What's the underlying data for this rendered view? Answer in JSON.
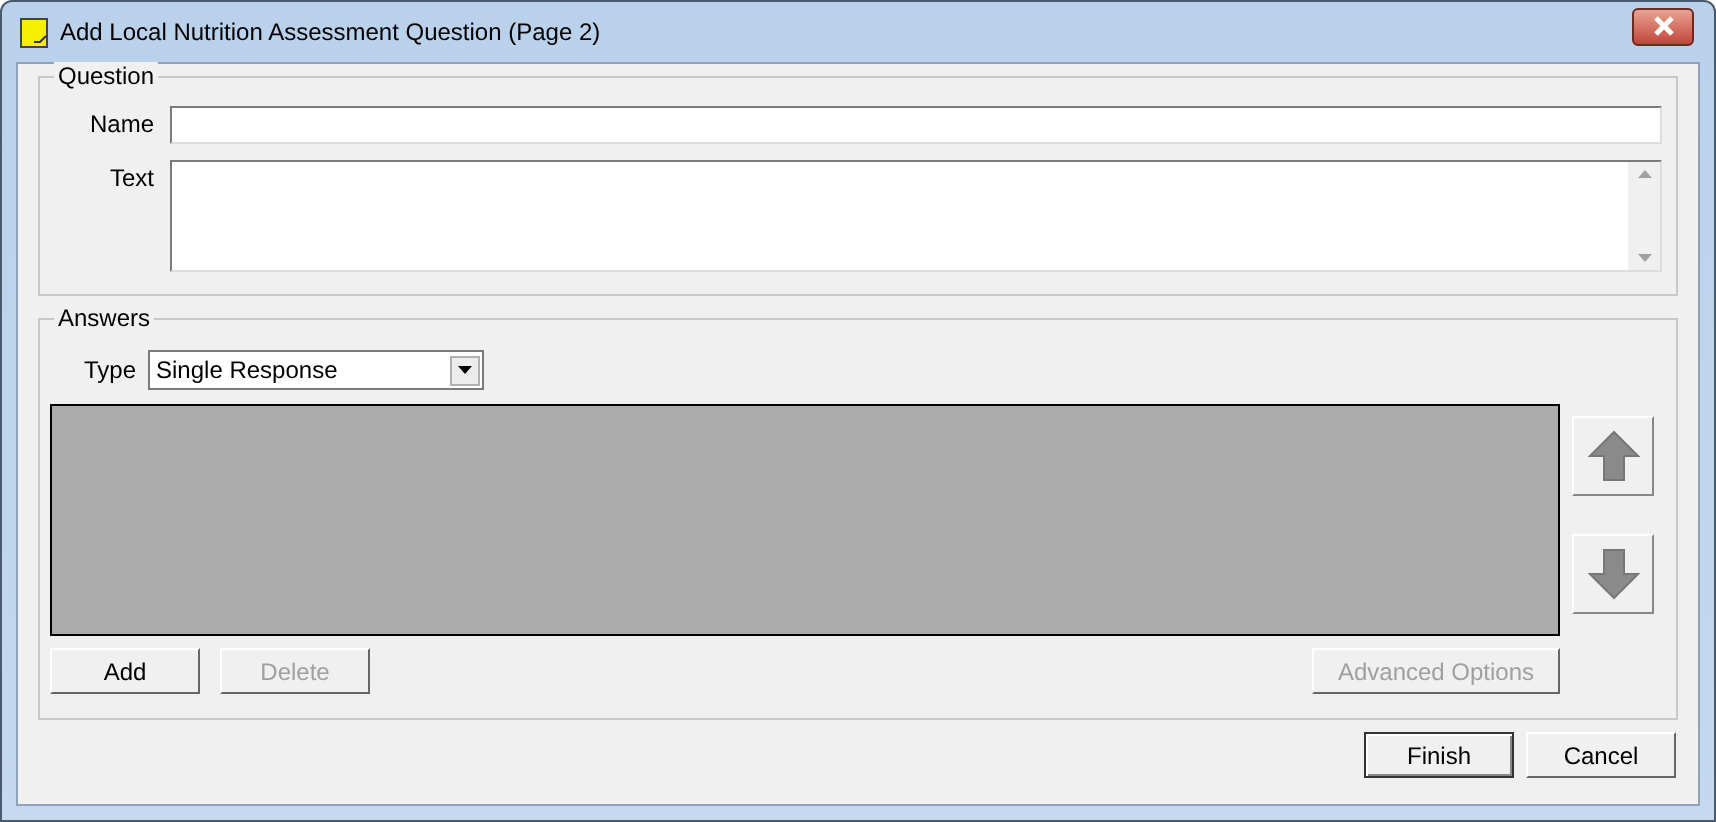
{
  "window": {
    "title": "Add Local Nutrition Assessment Question (Page 2)"
  },
  "question": {
    "legend": "Question",
    "fields": [
      {
        "label": "Name",
        "kind": "line"
      },
      {
        "label": "Text",
        "kind": "multiline"
      }
    ]
  },
  "answers": {
    "legend": "Answers",
    "type_label": "Type",
    "type_value": "Single Response",
    "buttons": [
      {
        "label": "Add",
        "disabled": false
      },
      {
        "label": "Delete",
        "disabled": true
      }
    ],
    "advanced": {
      "label": "Advanced Options",
      "disabled": true
    }
  },
  "footer_buttons": [
    {
      "label": "Finish",
      "disabled": false,
      "default": true
    },
    {
      "label": "Cancel",
      "disabled": false,
      "default": false
    }
  ]
}
